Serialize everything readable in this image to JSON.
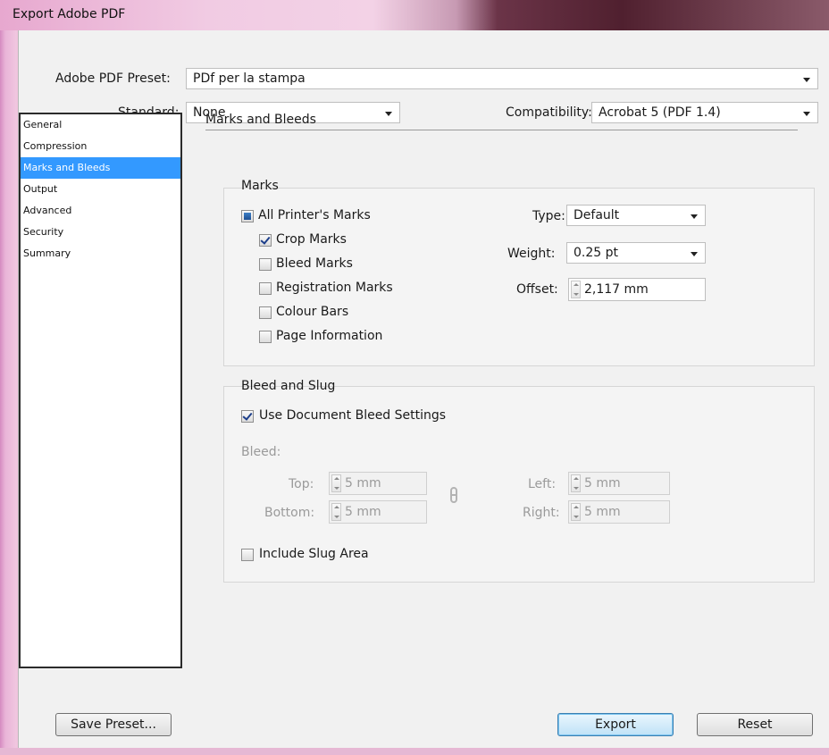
{
  "window": {
    "title": "Export Adobe PDF"
  },
  "preset": {
    "label": "Adobe PDF Preset:",
    "value": "PDf per la stampa"
  },
  "standard": {
    "label": "Standard:",
    "value": "None"
  },
  "compatibility": {
    "label": "Compatibility:",
    "value": "Acrobat 5 (PDF 1.4)"
  },
  "sidebar": {
    "items": [
      {
        "label": "General",
        "selected": false
      },
      {
        "label": "Compression",
        "selected": false
      },
      {
        "label": "Marks and Bleeds",
        "selected": true
      },
      {
        "label": "Output",
        "selected": false
      },
      {
        "label": "Advanced",
        "selected": false
      },
      {
        "label": "Security",
        "selected": false
      },
      {
        "label": "Summary",
        "selected": false
      }
    ]
  },
  "panel": {
    "title": "Marks and Bleeds"
  },
  "marks": {
    "title": "Marks",
    "all_printers_marks": "All Printer's Marks",
    "crop_marks": "Crop Marks",
    "bleed_marks": "Bleed Marks",
    "registration_marks": "Registration Marks",
    "colour_bars": "Colour Bars",
    "page_information": "Page Information",
    "type_label": "Type:",
    "type_value": "Default",
    "weight_label": "Weight:",
    "weight_value": "0.25 pt",
    "offset_label": "Offset:",
    "offset_value": "2,117 mm"
  },
  "bleed": {
    "title": "Bleed and Slug",
    "use_document_bleed": "Use Document Bleed Settings",
    "bleed_label": "Bleed:",
    "top_label": "Top:",
    "top_value": "5 mm",
    "bottom_label": "Bottom:",
    "bottom_value": "5 mm",
    "left_label": "Left:",
    "left_value": "5 mm",
    "right_label": "Right:",
    "right_value": "5 mm",
    "include_slug": "Include Slug Area"
  },
  "buttons": {
    "save_preset": "Save Preset...",
    "export": "Export",
    "reset": "Reset"
  }
}
